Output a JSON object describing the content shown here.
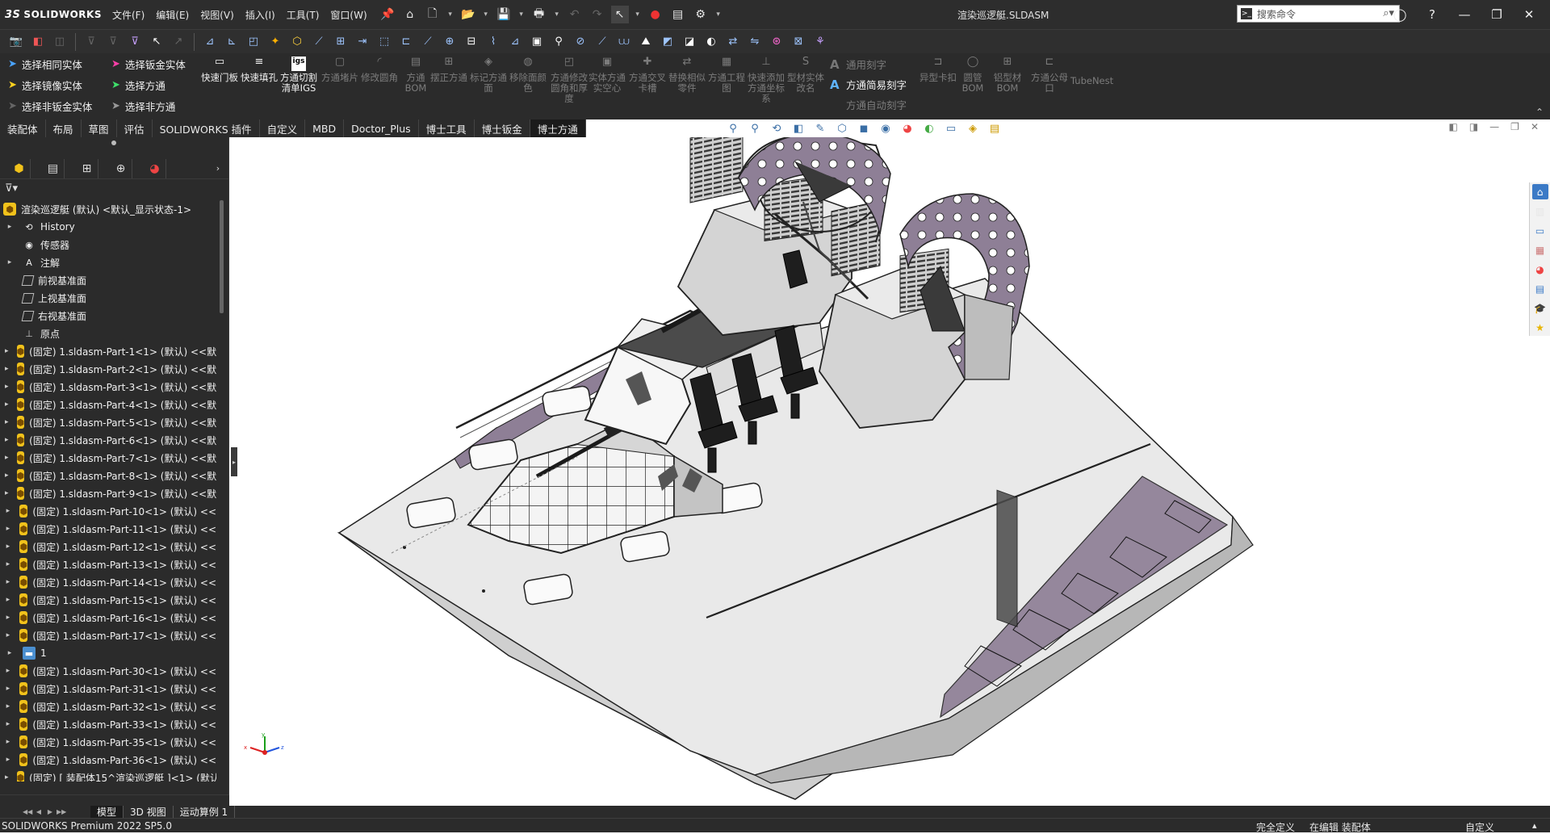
{
  "app": {
    "brand": "SOLIDWORKS",
    "document_title": "渲染巡逻艇.SLDASM",
    "menu": [
      "文件(F)",
      "编辑(E)",
      "视图(V)",
      "插入(I)",
      "工具(T)",
      "窗口(W)"
    ],
    "search_placeholder": "搜索命令"
  },
  "command_manager": {
    "select_left": [
      "选择相同实体",
      "选择镜像实体",
      "选择非钣金实体"
    ],
    "select_right": [
      "选择钣金实体",
      "选择方通",
      "选择非方通"
    ],
    "buttons": [
      {
        "label": "快速门板",
        "enabled": true
      },
      {
        "label": "快速填孔",
        "enabled": true
      },
      {
        "label": "方通切割清单IGS",
        "enabled": true
      },
      {
        "label": "方通堵片",
        "enabled": false
      },
      {
        "label": "修改圆角",
        "enabled": false
      },
      {
        "label": "方通BOM",
        "enabled": false
      },
      {
        "label": "摆正方通",
        "enabled": false
      },
      {
        "label": "标记方通面",
        "enabled": false
      },
      {
        "label": "移除面颜色",
        "enabled": false
      },
      {
        "label": "方通修改圆角和厚度",
        "enabled": false
      },
      {
        "label": "实体方通实空心",
        "enabled": false
      },
      {
        "label": "方通交叉卡槽",
        "enabled": false
      },
      {
        "label": "替换相似零件",
        "enabled": false
      },
      {
        "label": "方通工程图",
        "enabled": false
      },
      {
        "label": "快速添加方通坐标系",
        "enabled": false
      },
      {
        "label": "型材实体改名",
        "enabled": false
      }
    ],
    "carve": {
      "general": "通用刻字",
      "simple": "方通简易刻字",
      "auto": "方通自动刻字"
    },
    "buttons_right": [
      {
        "label": "异型卡扣",
        "enabled": false
      },
      {
        "label": "圆管BOM",
        "enabled": false
      },
      {
        "label": "铝型材BOM",
        "enabled": false
      },
      {
        "label": "方通公母口",
        "enabled": false
      },
      {
        "label": "TubeNest",
        "enabled": false
      }
    ]
  },
  "tabs": [
    "装配体",
    "布局",
    "草图",
    "评估",
    "SOLIDWORKS 插件",
    "自定义",
    "MBD",
    "Doctor_Plus",
    "博士工具",
    "博士钣金",
    "博士方通"
  ],
  "active_tab": "博士方通",
  "feature_tree": {
    "root": "渲染巡逻艇 (默认) <默认_显示状态-1>",
    "items": [
      {
        "label": "History",
        "icon": "history-icon",
        "expand": "▸"
      },
      {
        "label": "传感器",
        "icon": "sensor-icon",
        "expand": ""
      },
      {
        "label": "注解",
        "icon": "annotation-icon",
        "expand": "▸"
      },
      {
        "label": "前视基准面",
        "icon": "plane-icon",
        "expand": ""
      },
      {
        "label": "上视基准面",
        "icon": "plane-icon",
        "expand": ""
      },
      {
        "label": "右视基准面",
        "icon": "plane-icon",
        "expand": ""
      },
      {
        "label": "原点",
        "icon": "origin-icon",
        "expand": ""
      },
      {
        "label": "(固定) 1.sldasm-Part-1<1> (默认) <<默",
        "icon": "part-icon",
        "expand": "▸"
      },
      {
        "label": "(固定) 1.sldasm-Part-2<1> (默认) <<默",
        "icon": "part-icon",
        "expand": "▸"
      },
      {
        "label": "(固定) 1.sldasm-Part-3<1> (默认) <<默",
        "icon": "part-icon",
        "expand": "▸"
      },
      {
        "label": "(固定) 1.sldasm-Part-4<1> (默认) <<默",
        "icon": "part-icon",
        "expand": "▸"
      },
      {
        "label": "(固定) 1.sldasm-Part-5<1> (默认) <<默",
        "icon": "part-icon",
        "expand": "▸"
      },
      {
        "label": "(固定) 1.sldasm-Part-6<1> (默认) <<默",
        "icon": "part-icon",
        "expand": "▸"
      },
      {
        "label": "(固定) 1.sldasm-Part-7<1> (默认) <<默",
        "icon": "part-icon",
        "expand": "▸"
      },
      {
        "label": "(固定) 1.sldasm-Part-8<1> (默认) <<默",
        "icon": "part-icon",
        "expand": "▸"
      },
      {
        "label": "(固定) 1.sldasm-Part-9<1> (默认) <<默",
        "icon": "part-icon",
        "expand": "▸"
      },
      {
        "label": "(固定) 1.sldasm-Part-10<1> (默认) <<",
        "icon": "part-icon",
        "expand": "▸"
      },
      {
        "label": "(固定) 1.sldasm-Part-11<1> (默认) <<",
        "icon": "part-icon",
        "expand": "▸"
      },
      {
        "label": "(固定) 1.sldasm-Part-12<1> (默认) <<",
        "icon": "part-icon",
        "expand": "▸"
      },
      {
        "label": "(固定) 1.sldasm-Part-13<1> (默认) <<",
        "icon": "part-icon",
        "expand": "▸"
      },
      {
        "label": "(固定) 1.sldasm-Part-14<1> (默认) <<",
        "icon": "part-icon",
        "expand": "▸"
      },
      {
        "label": "(固定) 1.sldasm-Part-15<1> (默认) <<",
        "icon": "part-icon",
        "expand": "▸"
      },
      {
        "label": "(固定) 1.sldasm-Part-16<1> (默认) <<",
        "icon": "part-icon",
        "expand": "▸"
      },
      {
        "label": "(固定) 1.sldasm-Part-17<1> (默认) <<",
        "icon": "part-icon",
        "expand": "▸"
      },
      {
        "label": "1",
        "icon": "folder-icon",
        "expand": "▸"
      },
      {
        "label": "(固定) 1.sldasm-Part-30<1> (默认) <<",
        "icon": "part-icon",
        "expand": "▸"
      },
      {
        "label": "(固定) 1.sldasm-Part-31<1> (默认) <<",
        "icon": "part-icon",
        "expand": "▸"
      },
      {
        "label": "(固定) 1.sldasm-Part-32<1> (默认) <<",
        "icon": "part-icon",
        "expand": "▸"
      },
      {
        "label": "(固定) 1.sldasm-Part-33<1> (默认) <<",
        "icon": "part-icon",
        "expand": "▸"
      },
      {
        "label": "(固定) 1.sldasm-Part-35<1> (默认) <<",
        "icon": "part-icon",
        "expand": "▸"
      },
      {
        "label": "(固定) 1.sldasm-Part-36<1> (默认) <<",
        "icon": "part-icon",
        "expand": "▸"
      },
      {
        "label": "(固定) [ 装配体15^渲染巡逻艇 ]<1> (默认",
        "icon": "part-icon",
        "expand": "▸"
      }
    ]
  },
  "bottom_tabs": [
    "模型",
    "3D 视图",
    "运动算例 1"
  ],
  "active_bottom_tab": "模型",
  "status": {
    "version": "SOLIDWORKS Premium 2022 SP5.0",
    "definition": "完全定义",
    "editing": "在编辑 装配体",
    "units": "自定义",
    "caret": "▴"
  },
  "colors": {
    "ui_dark": "#2b2b2b",
    "accent_blue": "#5fb3ff",
    "part_yellow": "#f1c21b",
    "boat_gray": "#d9d9d9",
    "boat_purple": "#8e7f96"
  }
}
